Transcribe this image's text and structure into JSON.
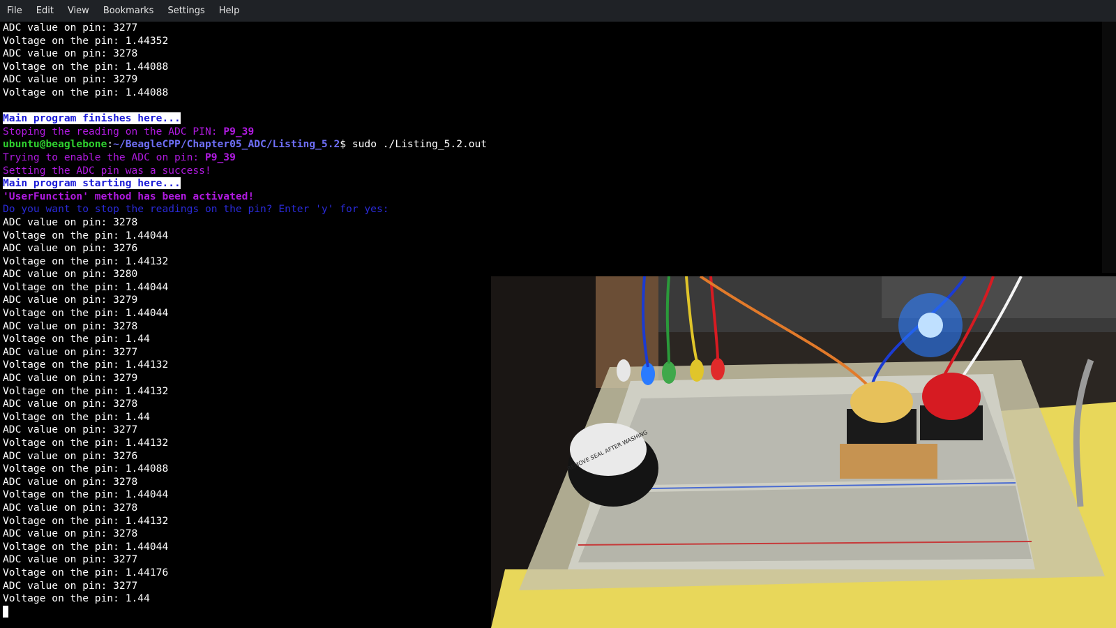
{
  "menubar": {
    "items": [
      "File",
      "Edit",
      "View",
      "Bookmarks",
      "Settings",
      "Help"
    ]
  },
  "terminal": {
    "lines": [
      {
        "segments": [
          {
            "text": "ADC value on pin: 3277",
            "style": "plain"
          }
        ]
      },
      {
        "segments": [
          {
            "text": "Voltage on the pin: 1.44352",
            "style": "plain"
          }
        ]
      },
      {
        "segments": [
          {
            "text": "ADC value on pin: 3278",
            "style": "plain"
          }
        ]
      },
      {
        "segments": [
          {
            "text": "Voltage on the pin: 1.44088",
            "style": "plain"
          }
        ]
      },
      {
        "segments": [
          {
            "text": "ADC value on pin: 3279",
            "style": "plain"
          }
        ]
      },
      {
        "segments": [
          {
            "text": "Voltage on the pin: 1.44088",
            "style": "plain"
          }
        ]
      },
      {
        "segments": [
          {
            "text": "",
            "style": "plain"
          }
        ]
      },
      {
        "segments": [
          {
            "text": "Main program finishes here...",
            "style": "hl-box"
          }
        ]
      },
      {
        "segments": [
          {
            "text": "Stoping the reading on the ADC PIN: ",
            "style": "purple"
          },
          {
            "text": "P9_39",
            "style": "purple-bold"
          }
        ]
      },
      {
        "segments": [
          {
            "text": "ubuntu@beaglebone",
            "style": "prompt-user"
          },
          {
            "text": ":",
            "style": "plain"
          },
          {
            "text": "~/BeagleCPP/Chapter05_ADC/Listing_5.2",
            "style": "prompt-path"
          },
          {
            "text": "$ sudo ./Listing_5.2.out",
            "style": "plain"
          }
        ]
      },
      {
        "segments": [
          {
            "text": "Trying to enable the ADC on pin: ",
            "style": "purple"
          },
          {
            "text": "P9_39",
            "style": "purple-bold"
          }
        ]
      },
      {
        "segments": [
          {
            "text": "Setting the ADC pin was a success!",
            "style": "purple"
          }
        ]
      },
      {
        "segments": [
          {
            "text": "Main program starting here...",
            "style": "hl-box"
          }
        ]
      },
      {
        "segments": [
          {
            "text": "'UserFunction' method has been activated!",
            "style": "purple-bold"
          }
        ]
      },
      {
        "segments": [
          {
            "text": "Do you want to stop the readings on the pin? Enter 'y' for yes:",
            "style": "blue-dim"
          }
        ]
      },
      {
        "segments": [
          {
            "text": "ADC value on pin: 3278",
            "style": "plain"
          }
        ]
      },
      {
        "segments": [
          {
            "text": "Voltage on the pin: 1.44044",
            "style": "plain"
          }
        ]
      },
      {
        "segments": [
          {
            "text": "ADC value on pin: 3276",
            "style": "plain"
          }
        ]
      },
      {
        "segments": [
          {
            "text": "Voltage on the pin: 1.44132",
            "style": "plain"
          }
        ]
      },
      {
        "segments": [
          {
            "text": "ADC value on pin: 3280",
            "style": "plain"
          }
        ]
      },
      {
        "segments": [
          {
            "text": "Voltage on the pin: 1.44044",
            "style": "plain"
          }
        ]
      },
      {
        "segments": [
          {
            "text": "ADC value on pin: 3279",
            "style": "plain"
          }
        ]
      },
      {
        "segments": [
          {
            "text": "Voltage on the pin: 1.44044",
            "style": "plain"
          }
        ]
      },
      {
        "segments": [
          {
            "text": "ADC value on pin: 3278",
            "style": "plain"
          }
        ]
      },
      {
        "segments": [
          {
            "text": "Voltage on the pin: 1.44",
            "style": "plain"
          }
        ]
      },
      {
        "segments": [
          {
            "text": "ADC value on pin: 3277",
            "style": "plain"
          }
        ]
      },
      {
        "segments": [
          {
            "text": "Voltage on the pin: 1.44132",
            "style": "plain"
          }
        ]
      },
      {
        "segments": [
          {
            "text": "ADC value on pin: 3279",
            "style": "plain"
          }
        ]
      },
      {
        "segments": [
          {
            "text": "Voltage on the pin: 1.44132",
            "style": "plain"
          }
        ]
      },
      {
        "segments": [
          {
            "text": "ADC value on pin: 3278",
            "style": "plain"
          }
        ]
      },
      {
        "segments": [
          {
            "text": "Voltage on the pin: 1.44",
            "style": "plain"
          }
        ]
      },
      {
        "segments": [
          {
            "text": "ADC value on pin: 3277",
            "style": "plain"
          }
        ]
      },
      {
        "segments": [
          {
            "text": "Voltage on the pin: 1.44132",
            "style": "plain"
          }
        ]
      },
      {
        "segments": [
          {
            "text": "ADC value on pin: 3276",
            "style": "plain"
          }
        ]
      },
      {
        "segments": [
          {
            "text": "Voltage on the pin: 1.44088",
            "style": "plain"
          }
        ]
      },
      {
        "segments": [
          {
            "text": "ADC value on pin: 3278",
            "style": "plain"
          }
        ]
      },
      {
        "segments": [
          {
            "text": "Voltage on the pin: 1.44044",
            "style": "plain"
          }
        ]
      },
      {
        "segments": [
          {
            "text": "ADC value on pin: 3278",
            "style": "plain"
          }
        ]
      },
      {
        "segments": [
          {
            "text": "Voltage on the pin: 1.44132",
            "style": "plain"
          }
        ]
      },
      {
        "segments": [
          {
            "text": "ADC value on pin: 3278",
            "style": "plain"
          }
        ]
      },
      {
        "segments": [
          {
            "text": "Voltage on the pin: 1.44044",
            "style": "plain"
          }
        ]
      },
      {
        "segments": [
          {
            "text": "ADC value on pin: 3277",
            "style": "plain"
          }
        ]
      },
      {
        "segments": [
          {
            "text": "Voltage on the pin: 1.44176",
            "style": "plain"
          }
        ]
      },
      {
        "segments": [
          {
            "text": "ADC value on pin: 3277",
            "style": "plain"
          }
        ]
      },
      {
        "segments": [
          {
            "text": "Voltage on the pin: 1.44",
            "style": "plain"
          }
        ]
      }
    ]
  },
  "camera": {
    "buzzer_label": "REMOVE SEAL AFTER WASHING",
    "colors": {
      "breadboard": "#cfcfc4",
      "desk": "#e8d75a",
      "led_blue": "#2a7bff",
      "led_green": "#3fa84a",
      "led_yellow": "#e0c52a",
      "led_red": "#e02a2a",
      "button_yellow": "#e7c15a",
      "button_red": "#d61b22"
    }
  }
}
